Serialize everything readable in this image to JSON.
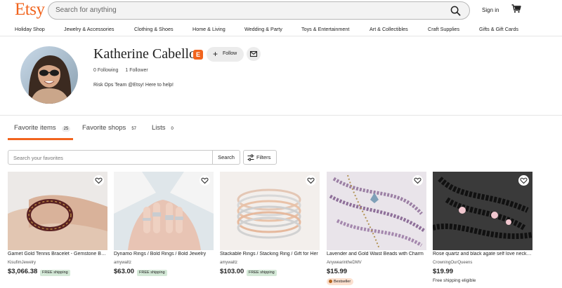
{
  "header": {
    "logo": "Etsy",
    "search_placeholder": "Search for anything",
    "signin_label": "Sign in"
  },
  "categories": [
    "Holiday Shop",
    "Jewelry & Accessories",
    "Clothing & Shoes",
    "Home & Living",
    "Wedding & Party",
    "Toys & Entertainment",
    "Art & Collectibles",
    "Craft Supplies",
    "Gifts & Gift Cards"
  ],
  "profile": {
    "name": "Katherine Cabello",
    "badge": "E",
    "follow_label": "Follow",
    "following": "0 Following",
    "followers": "1 Follower",
    "bio": "Risk Ops Team @Etsy! Here to help!"
  },
  "tabs": [
    {
      "label": "Favorite items",
      "count": "25",
      "active": true
    },
    {
      "label": "Favorite shops",
      "count": "57",
      "active": false
    },
    {
      "label": "Lists",
      "count": "0",
      "active": false
    }
  ],
  "favorites_search": {
    "placeholder": "Search your favorites",
    "button_label": "Search",
    "filters_label": "Filters"
  },
  "items": [
    {
      "title": "Garnet Gold Tennis Bracelet - Gemstone Bracelet",
      "shop": "KisufimJewelry",
      "price": "$3,066.38",
      "badge": "FREE shipping"
    },
    {
      "title": "Dynamo Rings / Bold Rings / Bold Jewelry",
      "shop": "amywaltz",
      "price": "$63.00",
      "badge": "FREE shipping"
    },
    {
      "title": "Stackable Rings / Stacking Ring / Gift for Her",
      "shop": "amywaltz",
      "price": "$103.00",
      "badge": "FREE shipping"
    },
    {
      "title": "Lavender and Gold Waist Beads with Charm",
      "shop": "AnywearintheDMV",
      "price": "$15.99",
      "badge": "Bestseller"
    },
    {
      "title": "Rose quartz and black agate self love necklace",
      "shop": "CrowningOurQueens",
      "price": "$19.99",
      "badge": "Free shipping eligible"
    }
  ],
  "colors": {
    "brand": "#F1641E",
    "free_shipping_bg": "#d4e9d7",
    "bestseller_bg": "#fbe0cf"
  }
}
